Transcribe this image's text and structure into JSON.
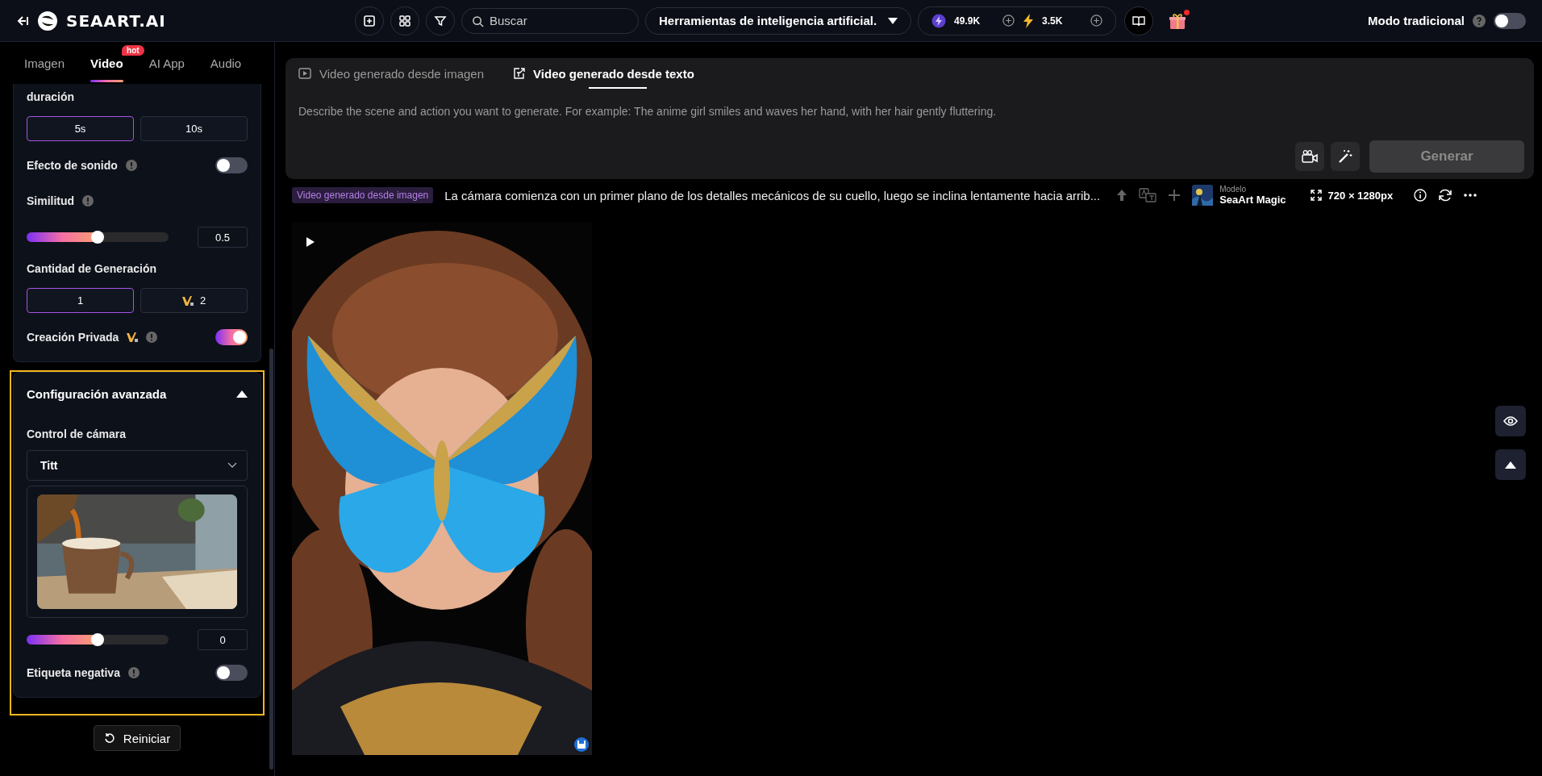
{
  "topbar": {
    "logo": "SEAART.AI",
    "search": {
      "placeholder": "Buscar"
    },
    "tools_menu": "Herramientas de inteligencia artificial.",
    "credits": [
      {
        "kind": "stamina",
        "value": "49.9K"
      },
      {
        "kind": "energy",
        "value": "3.5K"
      }
    ],
    "gift_badge": true,
    "mode_label": "Modo tradicional",
    "mode_toggle": {
      "on": false
    }
  },
  "sidebar": {
    "tabs": [
      {
        "label": "Imagen",
        "selected": false
      },
      {
        "label": "Video",
        "selected": true,
        "badge": "hot"
      },
      {
        "label": "AI App",
        "selected": false
      },
      {
        "label": "Audio",
        "selected": false
      }
    ],
    "duration": {
      "label": "duración",
      "options": [
        {
          "label": "5s",
          "selected": true
        },
        {
          "label": "10s",
          "selected": false
        }
      ]
    },
    "sound_effect": {
      "label": "Efecto de sonido",
      "on": false
    },
    "similarity": {
      "label": "Similitud",
      "level": 0.5,
      "reading": "0.5"
    },
    "quantity": {
      "label": "Cantidad de Generación",
      "options": [
        {
          "label": "1",
          "selected": true,
          "premium": false
        },
        {
          "label": "2",
          "selected": false,
          "premium": true
        }
      ]
    },
    "private": {
      "label": "Creación Privada",
      "on": true
    },
    "advanced": {
      "title": "Configuración avanzada",
      "expanded": true,
      "camera_label": "Control de cámara",
      "camera_value": "Titt",
      "level": 0.5,
      "reading": "0",
      "negative_label": "Etiqueta negativa",
      "negative_on": false
    },
    "reset": "Reiniciar"
  },
  "composer": {
    "tabs": [
      {
        "label": "Video generado desde imagen",
        "selected": false
      },
      {
        "label": "Video generado desde texto",
        "selected": true,
        "kind": "text"
      }
    ],
    "placeholder": "Describe the scene and action you want to generate. For example: The anime girl smiles and waves her hand, with her hair gently fluttering.",
    "generate": "Generar"
  },
  "result": {
    "tag": "Video generado desde imagen",
    "prompt": "La cámara comienza con un primer plano de los detalles mecánicos de su cuello, luego se inclina lentamente hacia arrib...",
    "model_caption": "Modelo",
    "model_name": "SeaArt Magic",
    "size": "720 × 1280px"
  }
}
